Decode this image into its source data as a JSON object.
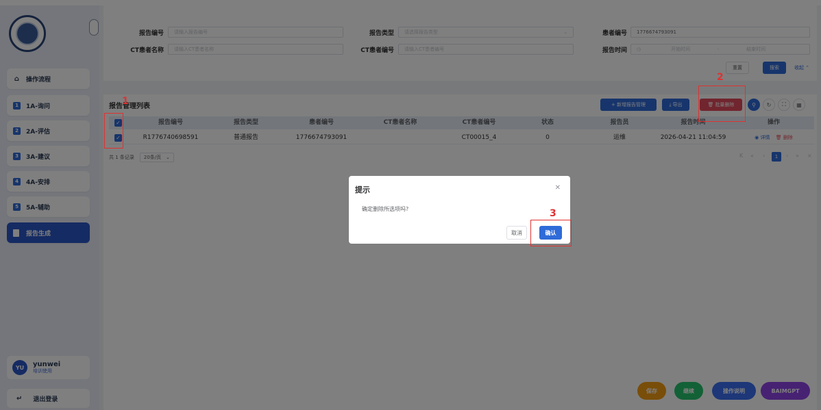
{
  "sidebar": {
    "nav": [
      {
        "label": "操作流程",
        "icon": "home-icon"
      },
      {
        "num": "1",
        "label": "1A-询问"
      },
      {
        "num": "2",
        "label": "2A-评估"
      },
      {
        "num": "3",
        "label": "3A-建议"
      },
      {
        "num": "4",
        "label": "4A-安排"
      },
      {
        "num": "5",
        "label": "5A-辅助"
      },
      {
        "label": "报告生成",
        "active": true
      }
    ],
    "user": {
      "avatar": "YU",
      "name": "yunwei",
      "role": "培训使用"
    },
    "logout": "退出登录"
  },
  "filter": {
    "report_no": {
      "label": "报告编号",
      "placeholder": "请输入报告编号"
    },
    "report_type": {
      "label": "报告类型",
      "placeholder": "请选择报告类型"
    },
    "patient_no": {
      "label": "患者编号",
      "value": "1776674793091"
    },
    "ct_name": {
      "label": "CT患者名称",
      "placeholder": "请输入CT患者名称"
    },
    "ct_no": {
      "label": "CT患者编号",
      "placeholder": "请输入CT患者编号"
    },
    "report_time": {
      "label": "报告时间",
      "start": "开始时间",
      "sep": "-",
      "end": "结束时间"
    },
    "reset": "重置",
    "search": "搜索",
    "collapse": "收起"
  },
  "table": {
    "title": "报告管理列表",
    "toolbar": {
      "add": "+ 新增报告管理",
      "export": "导出",
      "batch_delete": "批量删除"
    },
    "columns": [
      "报告编号",
      "报告类型",
      "患者编号",
      "CT患者名称",
      "CT患者编号",
      "状态",
      "报告员",
      "报告时间",
      "操作"
    ],
    "rows": [
      {
        "report_no": "R1776740698591",
        "type": "普通报告",
        "patient_no": "1776674793091",
        "ct_name": "",
        "ct_no": "CT00015_4",
        "status": "0",
        "reporter": "运维",
        "time": "2026-04-21 11:04:59",
        "detail": "详情",
        "delete": "删除"
      }
    ],
    "pager": {
      "total": "共 1 条记录",
      "size": "20条/页",
      "current": "1"
    }
  },
  "dialog": {
    "title": "提示",
    "message": "确定删除所选项吗?",
    "cancel": "取消",
    "confirm": "确认"
  },
  "annotations": {
    "step1": "1",
    "step2": "2",
    "step3": "3",
    "color": "#e03131"
  },
  "fabs": [
    "保存",
    "继续",
    "操作说明",
    "BAIMGPT"
  ],
  "colors": {
    "primary": "#2f6bd8",
    "danger": "#e34b5c",
    "save": "#f39c12",
    "continue": "#27c26c",
    "help": "#3b6ff0",
    "gpt": "#8e44e6"
  }
}
